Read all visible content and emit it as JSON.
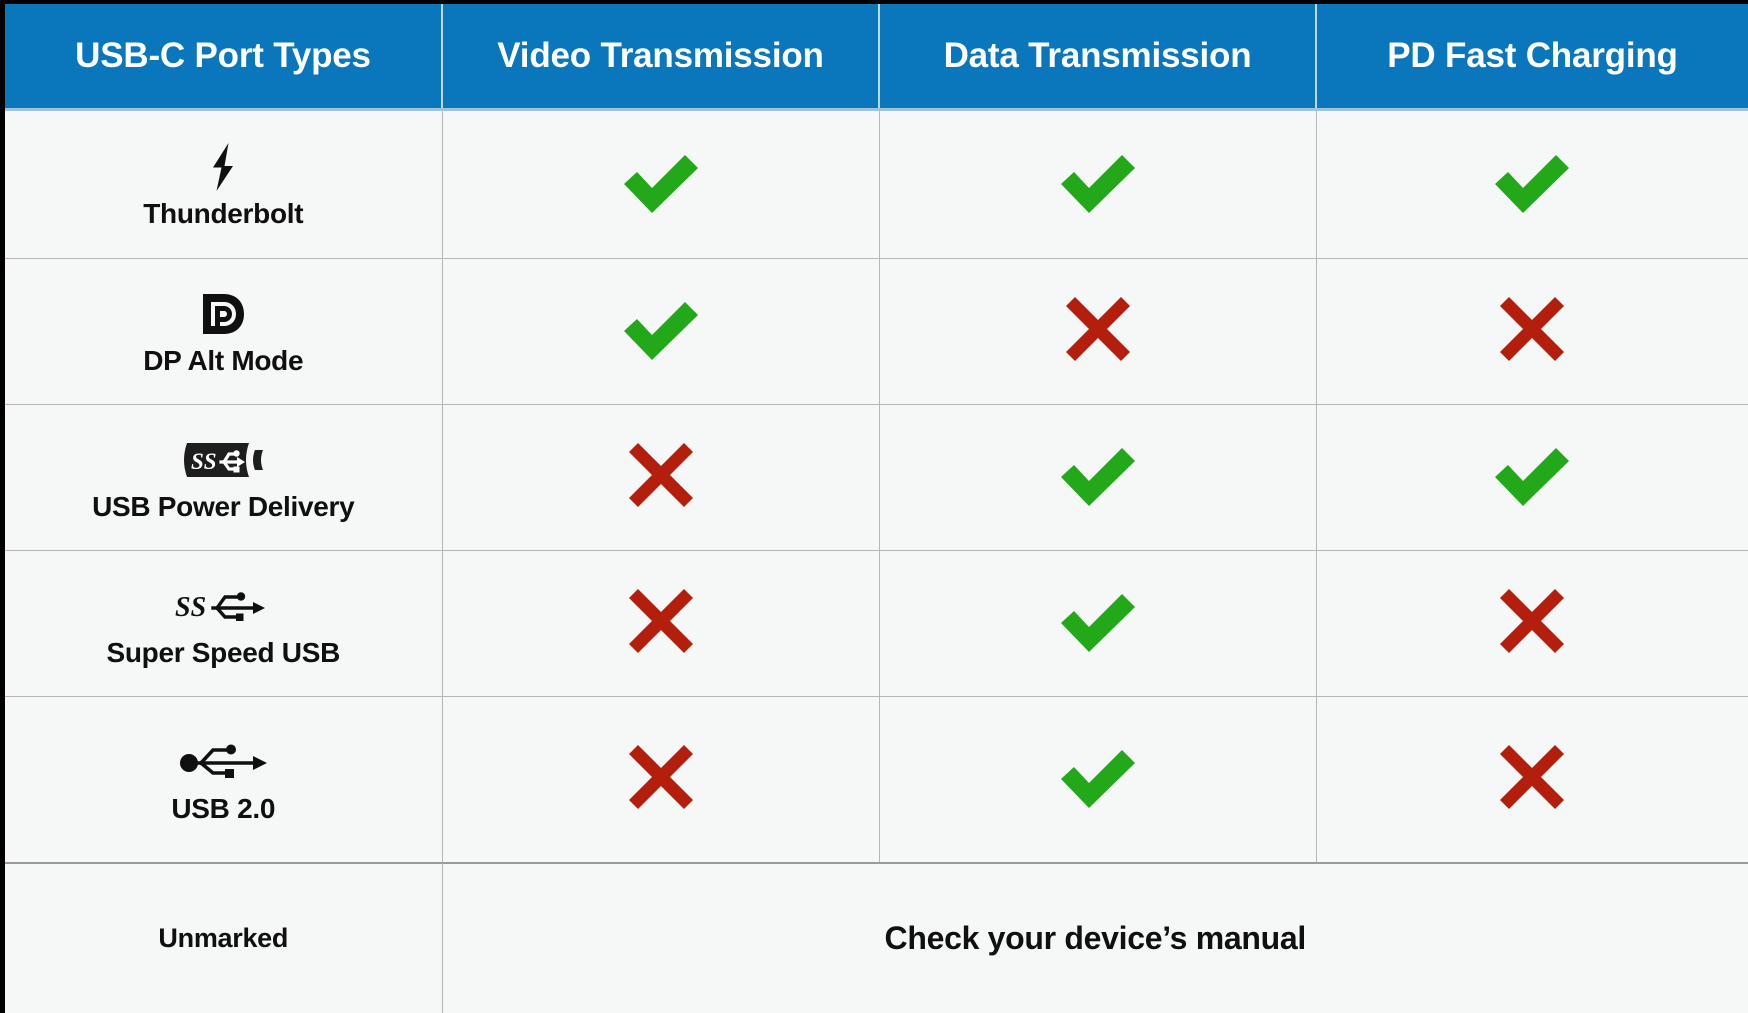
{
  "colors": {
    "header_bg": "#0A76BC",
    "header_text": "#FFFFFF",
    "cell_bg": "#F6F7F7",
    "grid_line": "#B6B6B6",
    "check_green": "#23A81A",
    "cross_red": "#B41E0C",
    "icon_black": "#101010",
    "frame_black": "#000000"
  },
  "table": {
    "headers": [
      {
        "label": "USB-C Port Types"
      },
      {
        "label": "Video Transmission"
      },
      {
        "label": "Data Transmission"
      },
      {
        "label": "PD Fast Charging"
      }
    ],
    "rows": [
      {
        "port": "Thunderbolt",
        "icon": "thunderbolt-icon",
        "video": "check",
        "data": "check",
        "charging": "check"
      },
      {
        "port": "DP Alt Mode",
        "icon": "displayport-icon",
        "video": "check",
        "data": "cross",
        "charging": "cross"
      },
      {
        "port": "USB Power Delivery",
        "icon": "usb-power-delivery-icon",
        "video": "cross",
        "data": "check",
        "charging": "check"
      },
      {
        "port": "Super Speed USB",
        "icon": "superspeed-usb-icon",
        "video": "cross",
        "data": "check",
        "charging": "cross"
      },
      {
        "port": "USB 2.0",
        "icon": "usb-trident-icon",
        "video": "cross",
        "data": "check",
        "charging": "cross"
      }
    ],
    "footer_row": {
      "port": "Unmarked",
      "note": "Check your device’s manual"
    }
  }
}
